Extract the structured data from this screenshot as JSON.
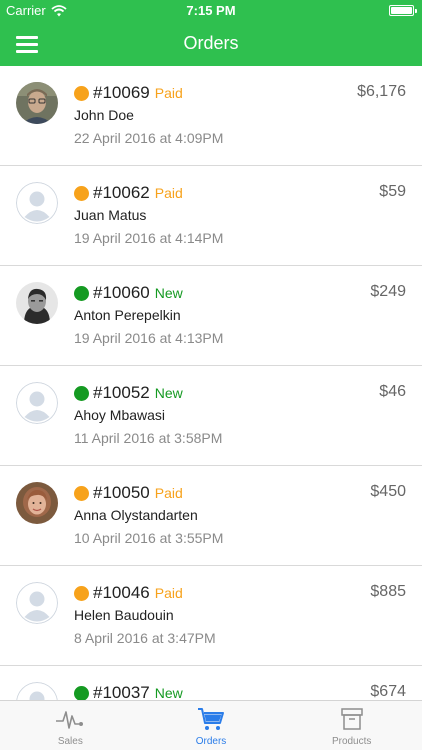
{
  "status_bar": {
    "carrier": "Carrier",
    "time": "7:15 PM"
  },
  "nav": {
    "title": "Orders"
  },
  "orders": [
    {
      "number": "#10069",
      "status": "Paid",
      "status_color": "#f7a21b",
      "customer": "John Doe",
      "date": "22 April 2016 at 4:09PM",
      "amount": "$6,176",
      "avatar": "photo-man-glasses"
    },
    {
      "number": "#10062",
      "status": "Paid",
      "status_color": "#f7a21b",
      "customer": "Juan Matus",
      "date": "19 April 2016 at 4:14PM",
      "amount": "$59",
      "avatar": "placeholder"
    },
    {
      "number": "#10060",
      "status": "New",
      "status_color": "#159a22",
      "customer": "Anton Perepelkin",
      "date": "19 April 2016 at 4:13PM",
      "amount": "$249",
      "avatar": "photo-man-dark"
    },
    {
      "number": "#10052",
      "status": "New",
      "status_color": "#159a22",
      "customer": "Ahoy Mbawasi",
      "date": "11 April 2016 at 3:58PM",
      "amount": "$46",
      "avatar": "placeholder"
    },
    {
      "number": "#10050",
      "status": "Paid",
      "status_color": "#f7a21b",
      "customer": "Anna Olystandarten",
      "date": "10 April 2016 at 3:55PM",
      "amount": "$450",
      "avatar": "photo-woman"
    },
    {
      "number": "#10046",
      "status": "Paid",
      "status_color": "#f7a21b",
      "customer": "Helen Baudouin",
      "date": "8 April 2016 at 3:47PM",
      "amount": "$885",
      "avatar": "placeholder"
    },
    {
      "number": "#10037",
      "status": "New",
      "status_color": "#159a22",
      "customer": "",
      "date": "",
      "amount": "$674",
      "avatar": "placeholder"
    }
  ],
  "tabs": [
    {
      "label": "Sales",
      "icon": "pulse-icon",
      "active": false
    },
    {
      "label": "Orders",
      "icon": "cart-icon",
      "active": true
    },
    {
      "label": "Products",
      "icon": "box-icon",
      "active": false
    }
  ],
  "colors": {
    "header": "#2fc04f",
    "paid": "#f7a21b",
    "new": "#159a22",
    "active_tab": "#2b7de9",
    "inactive_tab": "#8e8e8e"
  }
}
